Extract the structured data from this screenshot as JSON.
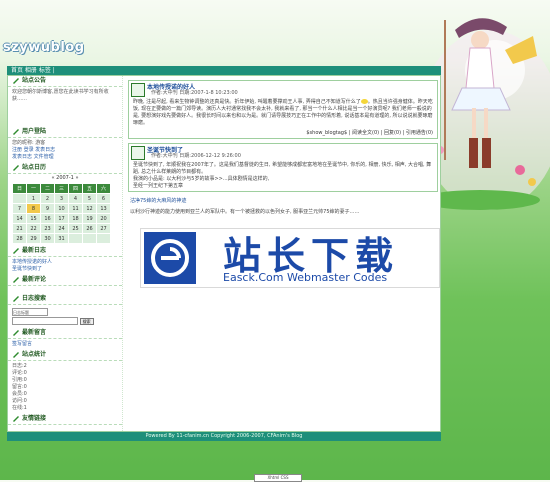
{
  "site": {
    "title": "szywublog",
    "nav_text": "首页 相册 标签 |"
  },
  "sidebar": {
    "announce": {
      "heading": "站点公告",
      "text": "欢迎您朝尔斯博客,愿您在此读书学习有所收获……"
    },
    "user": {
      "heading": "用户登陆",
      "line1": "您的昵称: 游客",
      "line2": "注册 登录 发表日志",
      "line3": "发表日志 文件管理"
    },
    "calendar": {
      "heading": "站点日历",
      "month": "2007-1",
      "weekdays": [
        "日",
        "一",
        "二",
        "三",
        "四",
        "五",
        "六"
      ],
      "weeks": [
        [
          "",
          "1",
          "2",
          "3",
          "4",
          "5",
          "6"
        ],
        [
          "7",
          "8",
          "9",
          "10",
          "11",
          "12",
          "13"
        ],
        [
          "14",
          "15",
          "16",
          "17",
          "18",
          "19",
          "20"
        ],
        [
          "21",
          "22",
          "23",
          "24",
          "25",
          "26",
          "27"
        ],
        [
          "28",
          "29",
          "30",
          "31",
          "",
          "",
          ""
        ]
      ],
      "today": "8"
    },
    "recent_posts": {
      "heading": "最新日志",
      "items": [
        "本地传授诺的好人",
        "圣诞节快到了"
      ]
    },
    "comments": {
      "heading": "最新评论"
    },
    "search": {
      "heading": "日志搜索",
      "select_value": "日志标题",
      "placeholder": "",
      "button": "搜索"
    },
    "guestbook": {
      "heading": "最新留言",
      "item": "签写留言"
    },
    "stats": {
      "heading": "站点统计",
      "lines": [
        "日志:2",
        "评论:0",
        "引用:0",
        "留言:0",
        "会员:0",
        "访问:0",
        "在线:1"
      ]
    },
    "links": {
      "heading": "友情链接"
    }
  },
  "posts": [
    {
      "title": "本地传授诺的好人",
      "meta": "作者:大中刊 日期:2007-1-8 10:23:00",
      "body_a": "昨晚, 注是尽起, 看来生物钟调整的还真是快。折年伊始, 叫醒着要撑劲王人事, 弄得自己不知道写什么了",
      "body_b": "。热且当许强身健体。昨天吃饭, 现在正要做的一篇门郊导读。演历人大衬通常找我不会太补, 我就来看了, 那当一个什么人相比是当一个好演员呢? 我们老师一般说的是, 要想演好戏先要做好人。我很长时间以来也和以为是。就门请导展技巧正在工作中的情形着, 说话基本是有道理的, 所以说说就要琢磨琢磨。",
      "footer": "$show_blogtag$ | 阅读全文(0) | 回复(0) | 引用通告(0)"
    },
    {
      "title": "圣诞节快到了",
      "meta": "作者:大中刊 日期:2006-12-12 9:26:00",
      "body_a": "圣诞节快到了, 年顺祝我在2007年了。这是我们基督徒的生日, 希望能够成都宏富地地在圣诞节中, 你乐的, 相册, 快乐, 相声, 大合唱, 舞蹈, 总之什么样莱朗的节目都有。",
      "body_b": "我演的小品是: 以大利沙与5岁的故事>>...具体剧情是这样的,",
      "body_c": "圣经一列王纪下第五章"
    }
  ],
  "long_text": {
    "line1": "沽净75婶的大麻风的神迹",
    "line2": "以利沙行神迹的能力使用到亚兰人的军队中。有一个被拯救的以色列女子, 服事亚兰元帅75婶的妻子……"
  },
  "footer": {
    "text": "Powered By 11-cfanim.cn Copyright 2006-2007, CFAnim's Blog",
    "badge": "Xhtml CSS"
  },
  "watermark": {
    "cn": "站长下载",
    "en": "Easck.Com Webmaster Codes"
  }
}
